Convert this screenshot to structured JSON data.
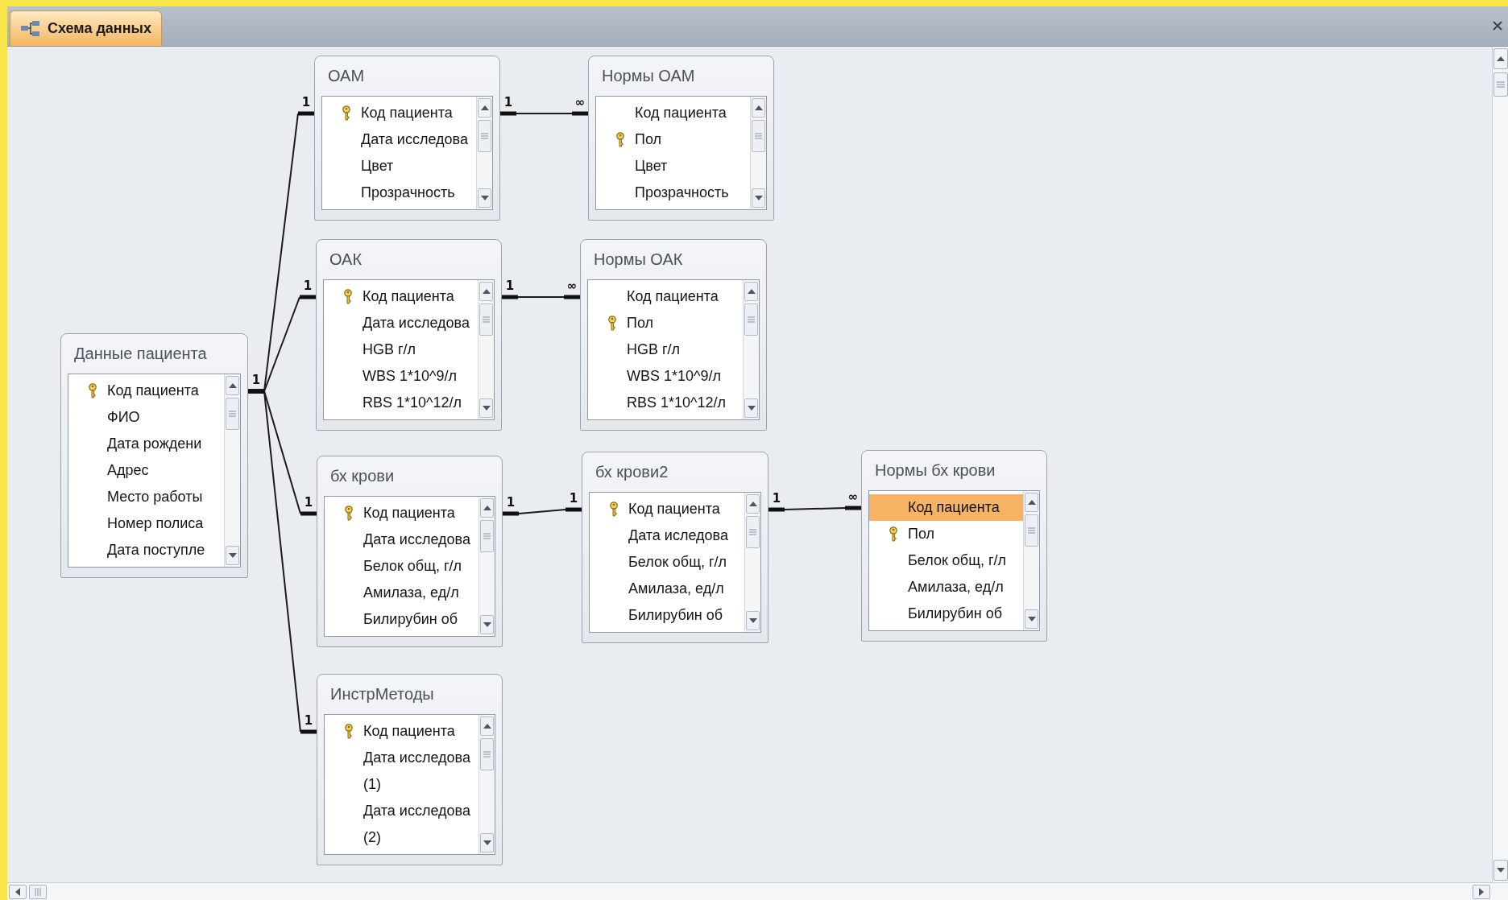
{
  "tab": {
    "label": "Схема данных"
  },
  "tables": [
    {
      "title": "ОАМ",
      "fields": [
        {
          "name": "Код пациента",
          "key": true,
          "selected": false
        },
        {
          "name": "Дата исследова",
          "key": false,
          "selected": false
        },
        {
          "name": "Цвет",
          "key": false,
          "selected": false
        },
        {
          "name": "Прозрачность",
          "key": false,
          "selected": false
        }
      ]
    },
    {
      "title": "Нормы ОАМ",
      "fields": [
        {
          "name": "Код пациента",
          "key": false,
          "selected": false
        },
        {
          "name": "Пол",
          "key": true,
          "selected": false
        },
        {
          "name": "Цвет",
          "key": false,
          "selected": false
        },
        {
          "name": "Прозрачность",
          "key": false,
          "selected": false
        }
      ]
    },
    {
      "title": "ОАК",
      "fields": [
        {
          "name": "Код пациента",
          "key": true,
          "selected": false
        },
        {
          "name": "Дата исследова",
          "key": false,
          "selected": false
        },
        {
          "name": "HGB г/л",
          "key": false,
          "selected": false
        },
        {
          "name": "WBS 1*10^9/л",
          "key": false,
          "selected": false
        },
        {
          "name": "RBS 1*10^12/л",
          "key": false,
          "selected": false
        }
      ]
    },
    {
      "title": "Нормы ОАК",
      "fields": [
        {
          "name": "Код пациента",
          "key": false,
          "selected": false
        },
        {
          "name": "Пол",
          "key": true,
          "selected": false
        },
        {
          "name": "HGB г/л",
          "key": false,
          "selected": false
        },
        {
          "name": "WBS 1*10^9/л",
          "key": false,
          "selected": false
        },
        {
          "name": "RBS 1*10^12/л",
          "key": false,
          "selected": false
        }
      ]
    },
    {
      "title": "Данные пациента",
      "fields": [
        {
          "name": "Код пациента",
          "key": true,
          "selected": false
        },
        {
          "name": "ФИО",
          "key": false,
          "selected": false
        },
        {
          "name": "Дата рождени",
          "key": false,
          "selected": false
        },
        {
          "name": "Адрес",
          "key": false,
          "selected": false
        },
        {
          "name": "Место работы",
          "key": false,
          "selected": false
        },
        {
          "name": "Номер полиса",
          "key": false,
          "selected": false
        },
        {
          "name": "Дата поступле",
          "key": false,
          "selected": false
        }
      ]
    },
    {
      "title": "бх крови",
      "fields": [
        {
          "name": "Код пациента",
          "key": true,
          "selected": false
        },
        {
          "name": "Дата исследова",
          "key": false,
          "selected": false
        },
        {
          "name": "Белок общ, г/л",
          "key": false,
          "selected": false
        },
        {
          "name": "Амилаза, ед/л",
          "key": false,
          "selected": false
        },
        {
          "name": "Билирубин об",
          "key": false,
          "selected": false
        }
      ]
    },
    {
      "title": "бх крови2",
      "fields": [
        {
          "name": "Код пациента",
          "key": true,
          "selected": false
        },
        {
          "name": "Дата иследова",
          "key": false,
          "selected": false
        },
        {
          "name": "Белок общ, г/л",
          "key": false,
          "selected": false
        },
        {
          "name": "Амилаза, ед/л",
          "key": false,
          "selected": false
        },
        {
          "name": "Билирубин об",
          "key": false,
          "selected": false
        }
      ]
    },
    {
      "title": "Нормы бх крови",
      "fields": [
        {
          "name": "Код пациента",
          "key": false,
          "selected": true
        },
        {
          "name": "Пол",
          "key": true,
          "selected": false
        },
        {
          "name": "Белок общ, г/л",
          "key": false,
          "selected": false
        },
        {
          "name": "Амилаза, ед/л",
          "key": false,
          "selected": false
        },
        {
          "name": "Билирубин об",
          "key": false,
          "selected": false
        }
      ]
    },
    {
      "title": "ИнстрМетоды",
      "fields": [
        {
          "name": "Код пациента",
          "key": true,
          "selected": false
        },
        {
          "name": "Дата исследова",
          "key": false,
          "selected": false
        },
        {
          "name": "(1)",
          "key": false,
          "selected": false
        },
        {
          "name": "Дата исследова",
          "key": false,
          "selected": false
        },
        {
          "name": "(2)",
          "key": false,
          "selected": false
        }
      ]
    }
  ],
  "relationships": [
    {
      "from_label": "1",
      "to_label": "1"
    },
    {
      "to_label": "1"
    },
    {
      "to_label": "1"
    },
    {
      "to_label": "1"
    },
    {
      "from_label": "1",
      "to_label": "∞"
    },
    {
      "from_label": "1",
      "to_label": "∞"
    },
    {
      "from_label": "1",
      "to_label": "1"
    },
    {
      "from_label": "1",
      "to_label": "∞"
    }
  ]
}
